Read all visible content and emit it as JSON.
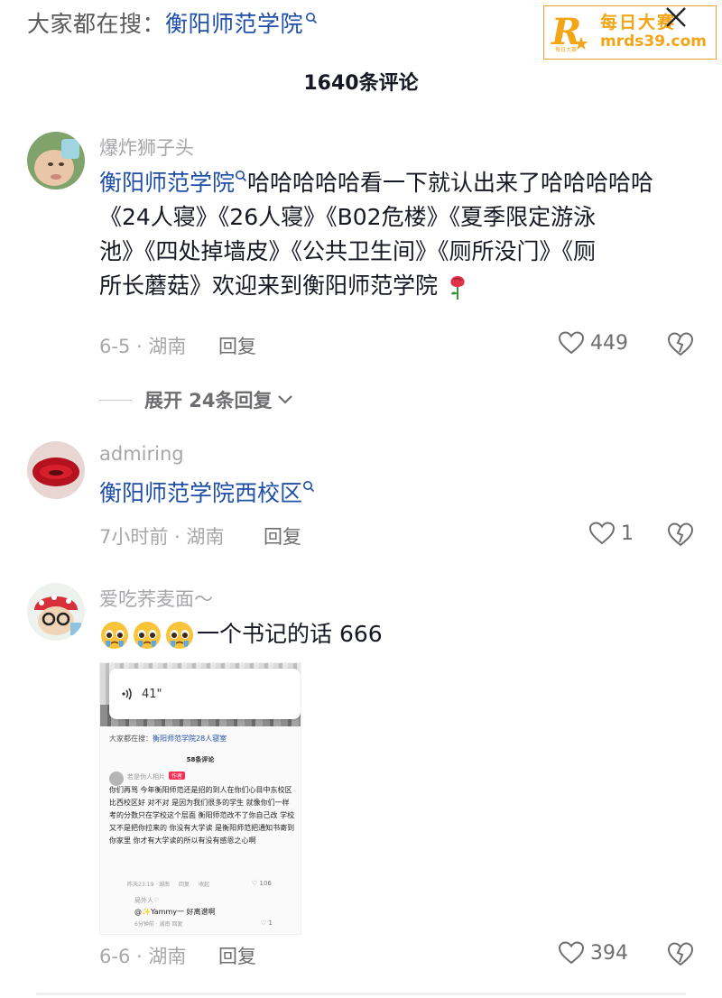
{
  "search": {
    "prefix": "大家都在搜：",
    "keyword": "衡阳师范学院"
  },
  "watermark": {
    "letter": "R",
    "sub": "每日大赛",
    "cn": "每日大赛",
    "url": "mrds39.com"
  },
  "header": {
    "count_label": "1640条评论"
  },
  "comments": [
    {
      "user": "爆炸狮子头",
      "keyword": "衡阳师范学院",
      "text_lines": [
        "哈哈哈哈哈看一下就认出来了哈哈哈哈哈",
        "《24人寝》《26人寝》《B02危楼》《夏季限定游泳",
        "池》《四处掉墙皮》《公共卫生间》《厕所没门》《厕",
        "所长蘑菇》欢迎来到衡阳师范学院"
      ],
      "date_loc": "6-5 · 湖南",
      "reply_label": "回复",
      "likes": "449",
      "expand_label": "展开 24条回复"
    },
    {
      "user": "admiring",
      "keyword": "衡阳师范学院西校区",
      "date_loc": "7小时前 · 湖南",
      "reply_label": "回复",
      "likes": "1"
    },
    {
      "user": "爱吃荞麦面～",
      "text": "一个书记的话 666",
      "date_loc": "6-6 · 湖南",
      "reply_label": "回复",
      "likes": "394"
    }
  ],
  "screenshot": {
    "voice_duration": "41\"",
    "search_prefix": "大家都在搜：",
    "search_keyword": "衡阳师范学院28人寝室",
    "count_label": "58条评论",
    "user": "若是伪人相片",
    "author_tag": "作者",
    "text": "你们再骂 今年衡阳师范还是招的到人在你们心目中东校区比西校区好 对不对 是因为我们很多的学生 就像你们一样 考的分数只在学校这个层面 衡阳师范改不了你自己改 学校又不是把你拉来的 你没有大学读 是衡阳师范把通知书寄到你家里 你才有大学读的所以有没有感恩之心啊",
    "meta_time": "昨天23:19 · 湖南",
    "meta_reply": "回复",
    "meta_collapse": "收起",
    "likes": "106",
    "reply_user": "局外人♡",
    "reply_text": "@✨Yammy一 好离谱啊",
    "reply_meta": "6分钟前 · 湖南   回复",
    "reply_likes": "1"
  },
  "colors": {
    "keyword": "#1f4fa8",
    "meta": "#a7a7ab",
    "watermark": "#f2a516"
  }
}
